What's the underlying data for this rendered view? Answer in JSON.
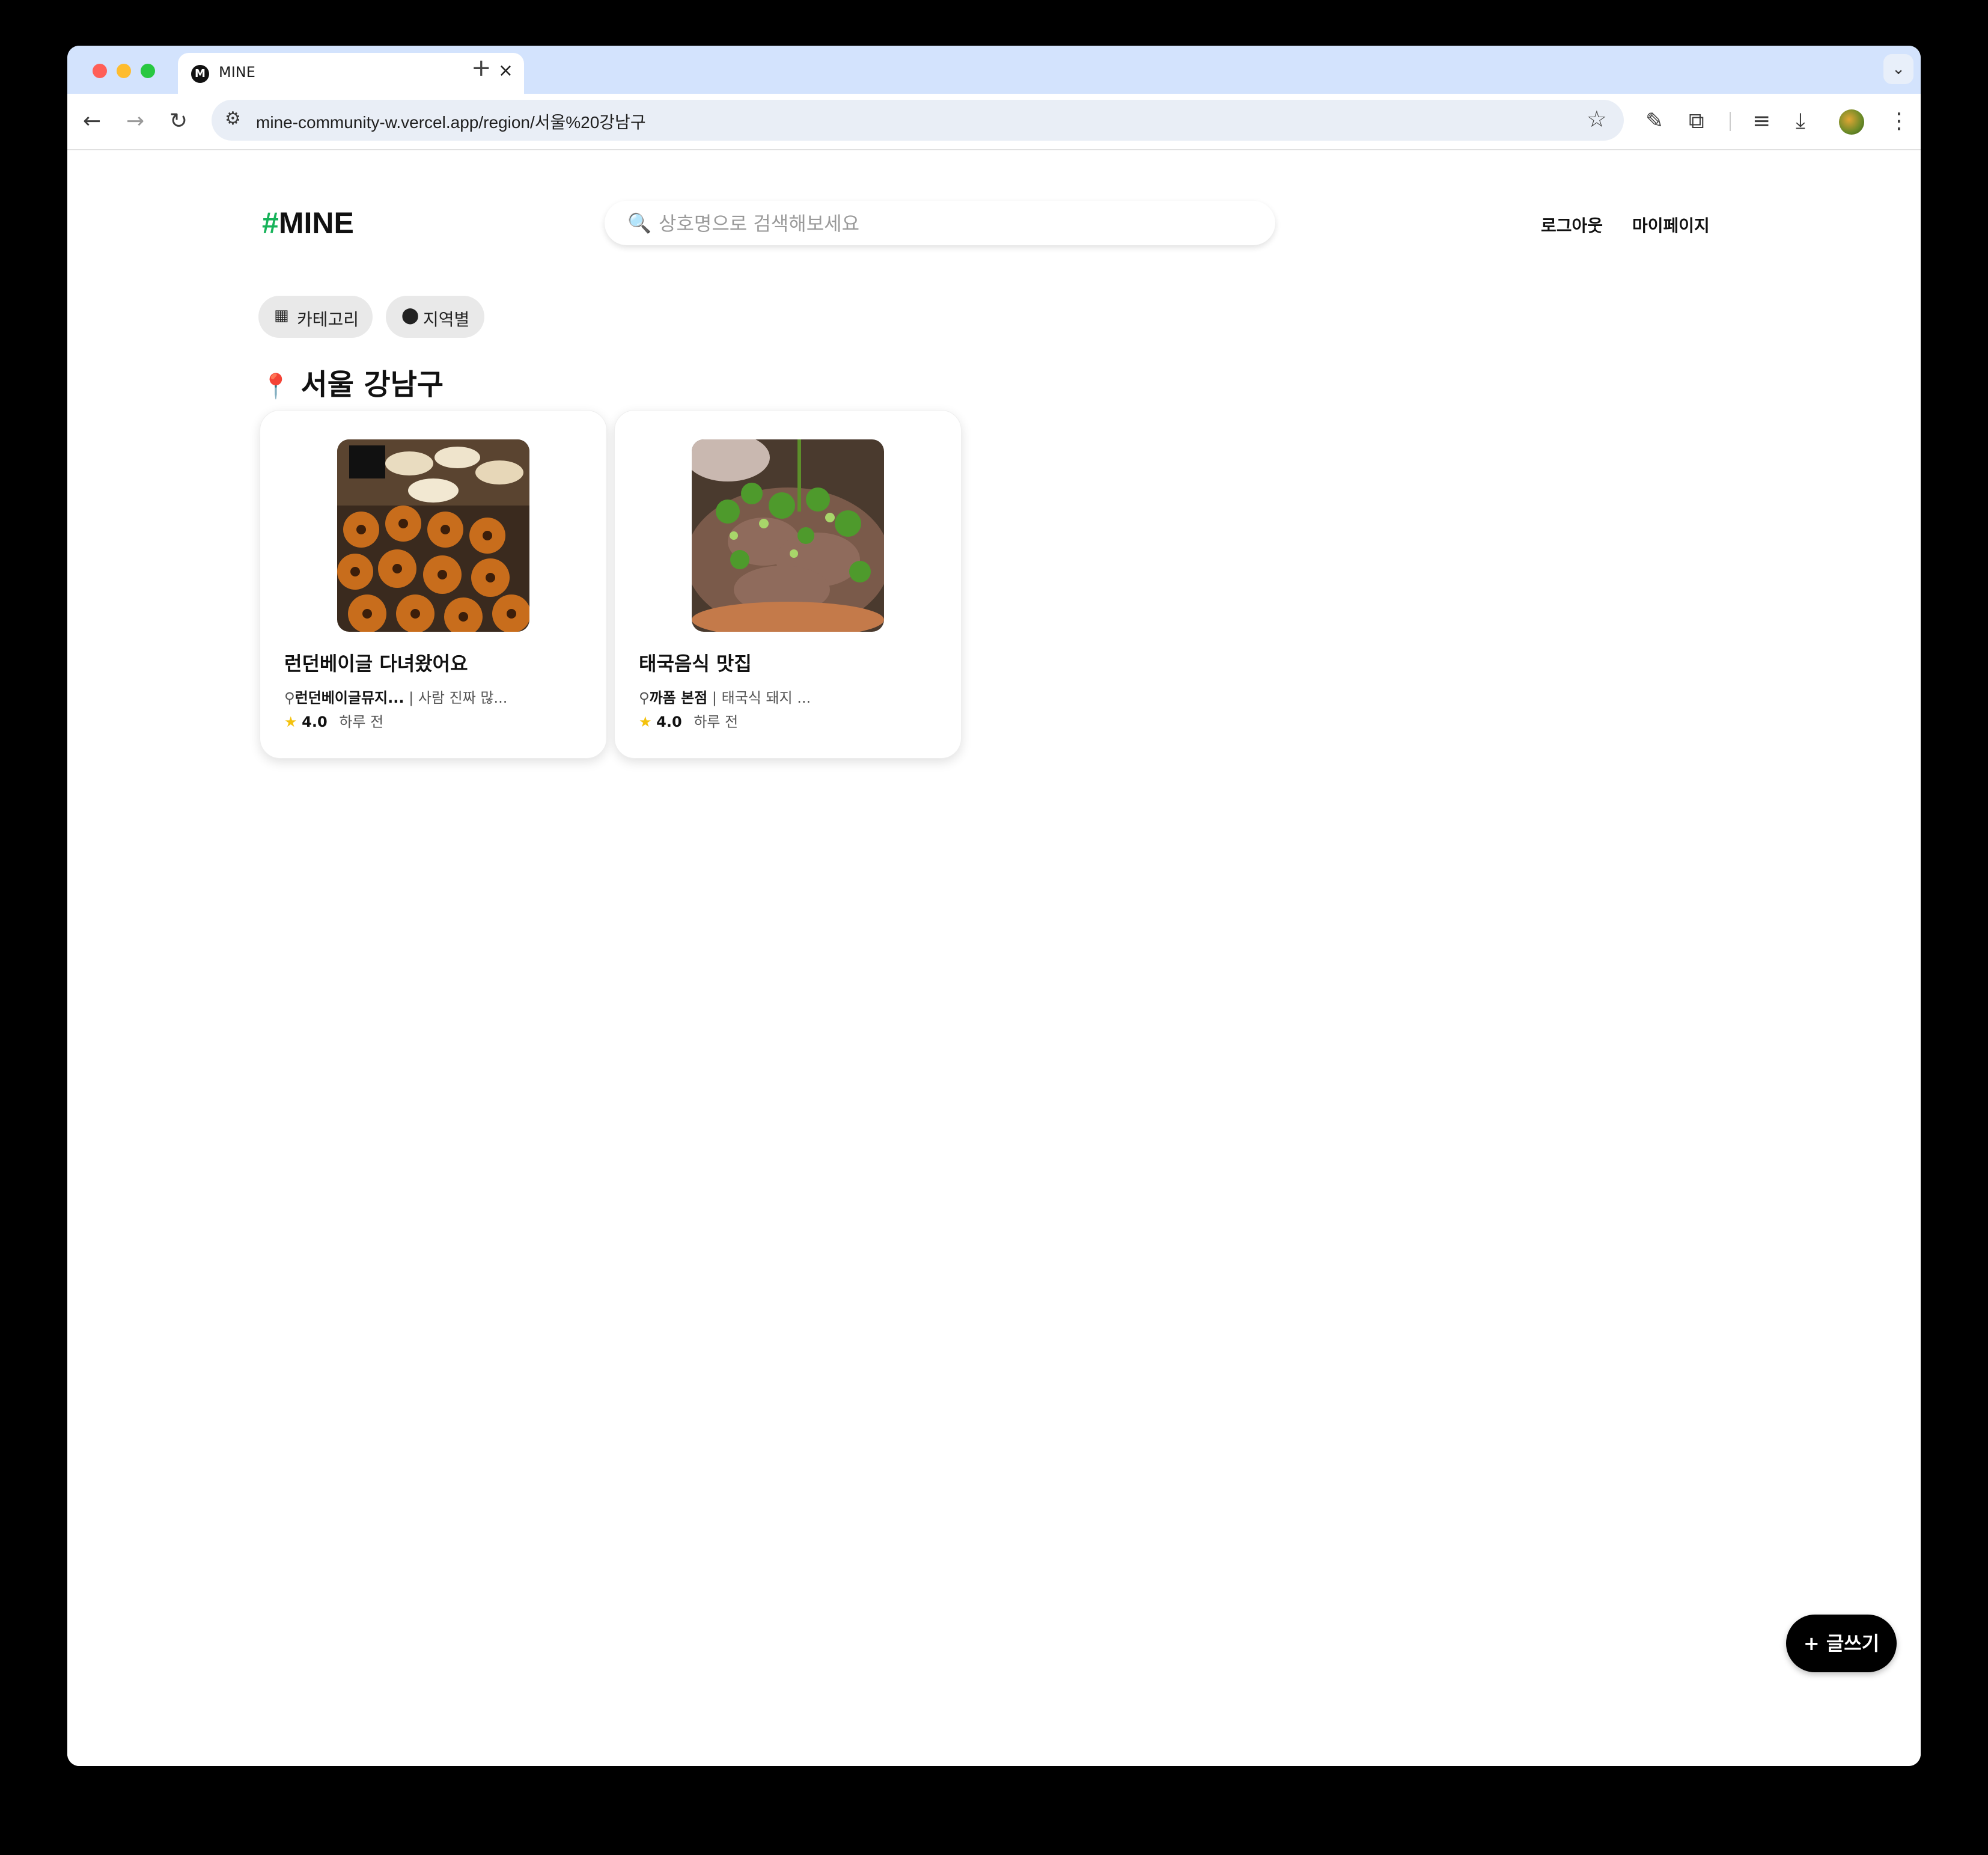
{
  "browser": {
    "tab_title": "MINE",
    "tab_favicon": "M",
    "url": "mine-community-w.vercel.app/region/서울%20강남구"
  },
  "header": {
    "logo_hash": "#",
    "logo_text": "MINE",
    "search_placeholder": "상호명으로 검색해보세요",
    "logout_label": "로그아웃",
    "mypage_label": "마이페이지"
  },
  "filters": {
    "category_label": "카테고리",
    "region_label": "지역별"
  },
  "region_title": "서울 강남구",
  "cards": [
    {
      "title": "런던베이글 다녀왔어요",
      "place": "런던베이글뮤지...",
      "snippet": "| 사람 진짜 많...",
      "rating": "4.0",
      "time": "하루 전"
    },
    {
      "title": "태국음식 맛집",
      "place": "까폼 본점",
      "snippet": "| 태국식 돼지 ...",
      "rating": "4.0",
      "time": "하루 전"
    }
  ],
  "write_button_label": "+ 글쓰기",
  "colors": {
    "accent_green": "#17b35a",
    "star_yellow": "#f4c20d",
    "tabstrip_blue": "#d3e3fd"
  }
}
